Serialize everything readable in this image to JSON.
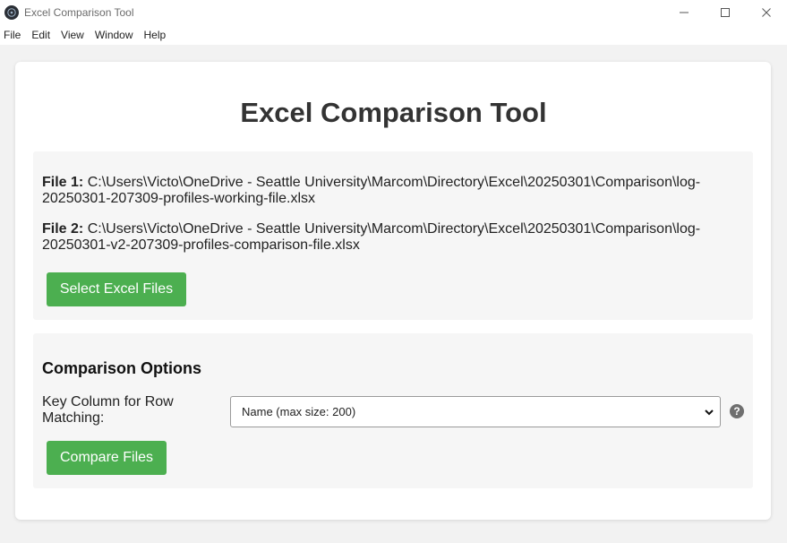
{
  "window": {
    "title": "Excel Comparison Tool"
  },
  "menu": {
    "items": [
      "File",
      "Edit",
      "View",
      "Window",
      "Help"
    ]
  },
  "page": {
    "title": "Excel Comparison Tool"
  },
  "files": {
    "file1_label": "File 1:",
    "file1_path_line1": "C:\\Users\\Victo\\OneDrive - Seattle University\\Marcom\\Directory\\Excel\\20250301\\Comparison\\log-",
    "file1_path_line2": "20250301-207309-profiles-working-file.xlsx",
    "file2_label": "File 2:",
    "file2_path_line1": "C:\\Users\\Victo\\OneDrive - Seattle University\\Marcom\\Directory\\Excel\\20250301\\Comparison\\log-",
    "file2_path_line2": "20250301-v2-207309-profiles-comparison-file.xlsx",
    "select_button_label": "Select Excel Files"
  },
  "options": {
    "heading": "Comparison Options",
    "key_column_label": "Key Column for Row Matching:",
    "key_column_selected": "Name (max size: 200)",
    "help_symbol": "?",
    "compare_button_label": "Compare Files"
  },
  "colors": {
    "accent_green": "#4caf50",
    "panel_bg": "#f6f6f6",
    "window_bg": "#f2f2f2"
  },
  "icons": {
    "app": "app-logo-icon",
    "minimize": "minimize-icon",
    "maximize": "maximize-icon",
    "close": "close-icon",
    "dropdown": "chevron-down-icon",
    "help": "help-icon"
  }
}
